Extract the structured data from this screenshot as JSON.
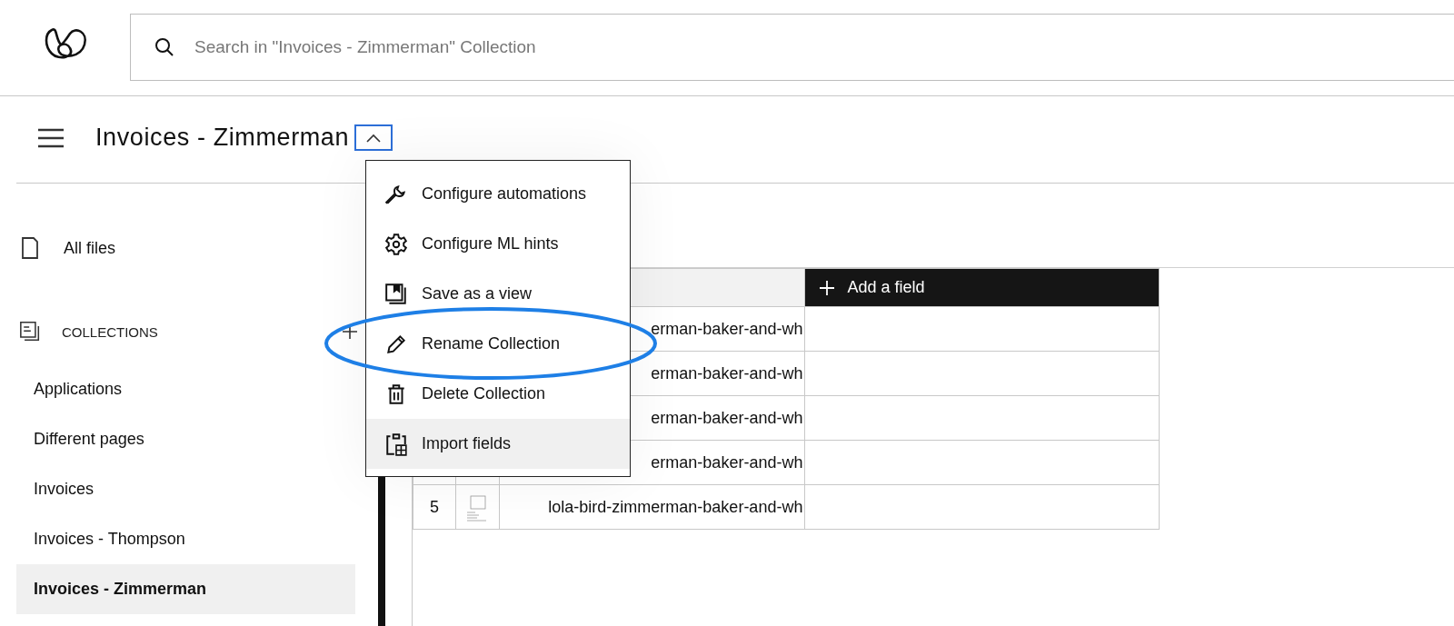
{
  "search": {
    "placeholder": "Search in \"Invoices - Zimmerman\" Collection"
  },
  "header": {
    "title": "Invoices - Zimmerman",
    "menu_expanded": true
  },
  "menu": {
    "items": [
      {
        "label": "Configure automations",
        "kind": "wrench",
        "hovered": false,
        "circled": false
      },
      {
        "label": "Configure ML hints",
        "kind": "gear",
        "hovered": false,
        "circled": false
      },
      {
        "label": "Save as a view",
        "kind": "view",
        "hovered": false,
        "circled": false
      },
      {
        "label": "Rename Collection",
        "kind": "pencil",
        "hovered": false,
        "circled": true
      },
      {
        "label": "Delete Collection",
        "kind": "trash",
        "hovered": false,
        "circled": false
      },
      {
        "label": "Import fields",
        "kind": "clipboard",
        "hovered": true,
        "circled": false
      }
    ]
  },
  "sidebar": {
    "all_files": "All files",
    "collections_heading": "COLLECTIONS",
    "items": [
      {
        "label": "Applications",
        "selected": false
      },
      {
        "label": "Different pages",
        "selected": false
      },
      {
        "label": "Invoices",
        "selected": false
      },
      {
        "label": "Invoices - Thompson",
        "selected": false
      },
      {
        "label": "Invoices - Zimmerman",
        "selected": true
      }
    ]
  },
  "table": {
    "add_field": "Add a field",
    "rows": [
      {
        "name": "erman-baker-and-wh",
        "thumbnail": false
      },
      {
        "name": "erman-baker-and-wh",
        "thumbnail": false
      },
      {
        "name": "erman-baker-and-wh",
        "thumbnail": false
      },
      {
        "name": "erman-baker-and-wh",
        "thumbnail": false
      },
      {
        "number": "5",
        "name": "lola-bird-zimmerman-baker-and-wh",
        "thumbnail": true
      }
    ]
  }
}
